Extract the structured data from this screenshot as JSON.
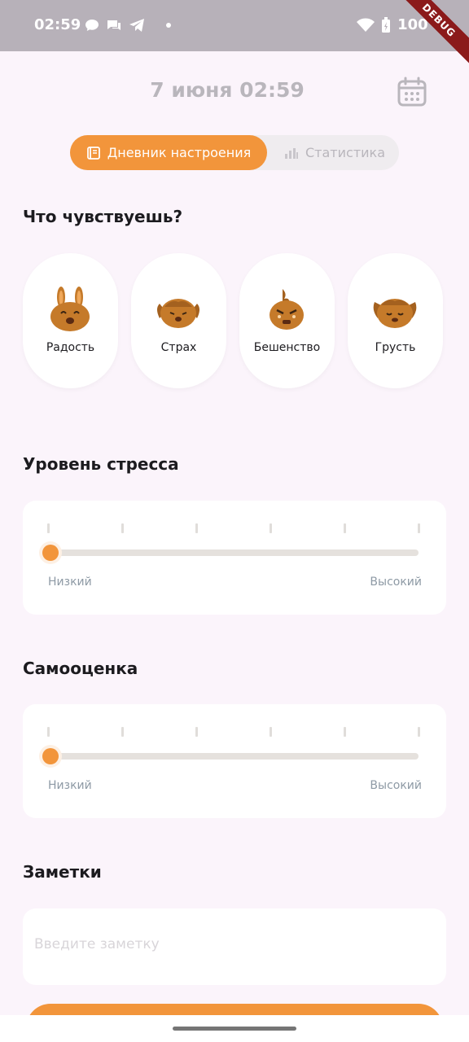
{
  "status_bar": {
    "time": "02:59",
    "battery": "100 %",
    "debug_label": "DEBUG"
  },
  "header": {
    "date": "7 июня 02:59"
  },
  "tabs": [
    {
      "label": "Дневник настроения",
      "active": true
    },
    {
      "label": "Статистика",
      "active": false
    }
  ],
  "mood_section": {
    "title": "Что чувствуешь?",
    "moods": [
      {
        "label": "Радость",
        "icon": "bunny-joy-icon"
      },
      {
        "label": "Страх",
        "icon": "bunny-fear-icon"
      },
      {
        "label": "Бешенство",
        "icon": "bunny-rage-icon"
      },
      {
        "label": "Грусть",
        "icon": "bunny-sad-icon"
      }
    ]
  },
  "stress": {
    "title": "Уровень стресса",
    "low_label": "Низкий",
    "high_label": "Высокий",
    "value": 0
  },
  "self_esteem": {
    "title": "Самооценка",
    "low_label": "Низкий",
    "high_label": "Высокий",
    "value": 0
  },
  "notes": {
    "title": "Заметки",
    "placeholder": "Введите заметку",
    "value": ""
  },
  "colors": {
    "accent": "#f2953b",
    "background": "#fbf4fb",
    "muted_text": "#b9b6bc"
  }
}
